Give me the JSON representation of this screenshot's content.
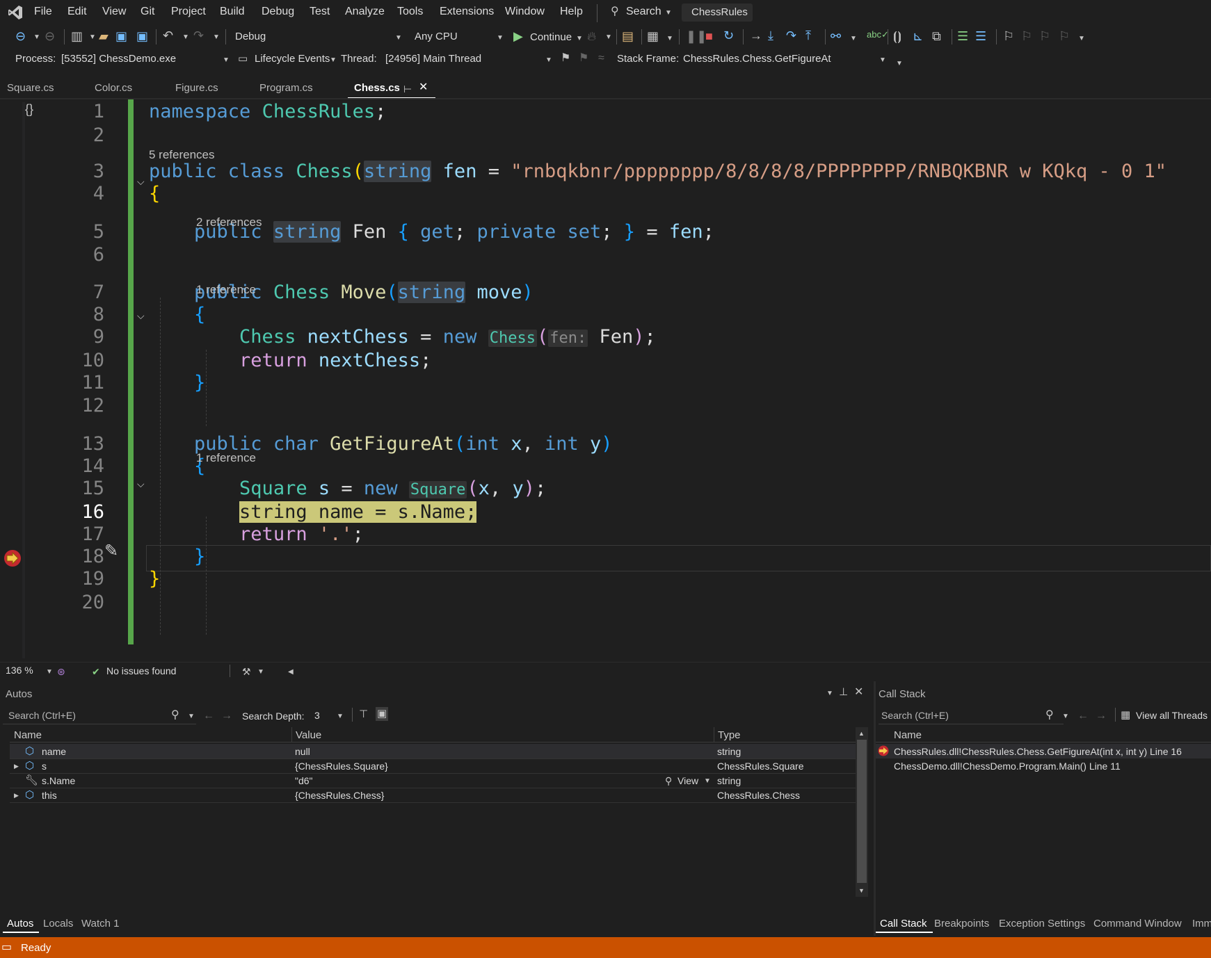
{
  "menu": {
    "items": [
      "File",
      "Edit",
      "View",
      "Git",
      "Project",
      "Build",
      "Debug",
      "Test",
      "Analyze",
      "Tools",
      "Extensions",
      "Window",
      "Help"
    ],
    "search_label": "Search",
    "solution_name": "ChessRules"
  },
  "toolbar": {
    "config": "Debug",
    "platform": "Any CPU",
    "continue_label": "Continue"
  },
  "debugbar": {
    "process_label": "Process:",
    "process_value": "[53552] ChessDemo.exe",
    "lifecycle_label": "Lifecycle Events",
    "thread_label": "Thread:",
    "thread_value": "[24956] Main Thread",
    "stackframe_label": "Stack Frame:",
    "stackframe_value": "ChessRules.Chess.GetFigureAt"
  },
  "tabs": [
    "Square.cs",
    "Color.cs",
    "Figure.cs",
    "Program.cs",
    "Chess.cs"
  ],
  "editor": {
    "refs": {
      "r3": "5 references",
      "r5": "2 references",
      "r7": "1 reference",
      "r13": "1 reference"
    },
    "lines": [
      {
        "n": "1",
        "tokens": [
          {
            "c": "k",
            "t": "namespace "
          },
          {
            "c": "t",
            "t": "ChessRules"
          },
          {
            "c": "w",
            "t": ";"
          }
        ]
      },
      {
        "n": "2",
        "tokens": []
      },
      {
        "n": "3",
        "tokens": [
          {
            "c": "k",
            "t": "public class "
          },
          {
            "c": "t",
            "t": "Chess"
          },
          {
            "c": "y",
            "t": "("
          },
          {
            "c": "k hl",
            "t": "string"
          },
          {
            "c": "p",
            "t": " fen"
          },
          {
            "c": "w",
            "t": " = "
          },
          {
            "c": "s",
            "t": "\"rnbqkbnr/pppppppp/8/8/8/8/PPPPPPPP/RNBQKBNR w KQkq - 0 1\""
          }
        ]
      },
      {
        "n": "4",
        "tokens": [
          {
            "c": "y",
            "t": "{"
          }
        ]
      },
      {
        "n": "5",
        "tokens": [
          {
            "c": "w",
            "t": "    "
          },
          {
            "c": "k",
            "t": "public "
          },
          {
            "c": "k hl",
            "t": "string"
          },
          {
            "c": "w",
            "t": " Fen "
          },
          {
            "c": "b",
            "t": "{"
          },
          {
            "c": "k",
            "t": " get"
          },
          {
            "c": "w",
            "t": "; "
          },
          {
            "c": "k",
            "t": "private set"
          },
          {
            "c": "w",
            "t": "; "
          },
          {
            "c": "b",
            "t": "}"
          },
          {
            "c": "w",
            "t": " = "
          },
          {
            "c": "p",
            "t": "fen"
          },
          {
            "c": "w",
            "t": ";"
          }
        ]
      },
      {
        "n": "6",
        "tokens": []
      },
      {
        "n": "7",
        "tokens": [
          {
            "c": "w",
            "t": "    "
          },
          {
            "c": "k",
            "t": "public "
          },
          {
            "c": "t",
            "t": "Chess "
          },
          {
            "c": "f",
            "t": "Move"
          },
          {
            "c": "b",
            "t": "("
          },
          {
            "c": "k hl",
            "t": "string"
          },
          {
            "c": "p",
            "t": " move"
          },
          {
            "c": "b",
            "t": ")"
          }
        ]
      },
      {
        "n": "8",
        "tokens": [
          {
            "c": "w",
            "t": "    "
          },
          {
            "c": "b",
            "t": "{"
          }
        ]
      },
      {
        "n": "9",
        "tokens": [
          {
            "c": "w",
            "t": "        "
          },
          {
            "c": "t",
            "t": "Chess "
          },
          {
            "c": "p",
            "t": "nextChess"
          },
          {
            "c": "w",
            "t": " = "
          },
          {
            "c": "k",
            "t": "new "
          },
          {
            "c": "t hint",
            "t": "Chess"
          },
          {
            "c": "c",
            "t": "("
          },
          {
            "c": "hint",
            "t": "fen:"
          },
          {
            "c": "w",
            "t": " Fen"
          },
          {
            "c": "c",
            "t": ")"
          },
          {
            "c": "w",
            "t": ";"
          }
        ]
      },
      {
        "n": "10",
        "tokens": [
          {
            "c": "w",
            "t": "        "
          },
          {
            "c": "c",
            "t": "return "
          },
          {
            "c": "p",
            "t": "nextChess"
          },
          {
            "c": "w",
            "t": ";"
          }
        ]
      },
      {
        "n": "11",
        "tokens": [
          {
            "c": "w",
            "t": "    "
          },
          {
            "c": "b",
            "t": "}"
          }
        ]
      },
      {
        "n": "12",
        "tokens": []
      },
      {
        "n": "13",
        "tokens": [
          {
            "c": "w",
            "t": "    "
          },
          {
            "c": "k",
            "t": "public char "
          },
          {
            "c": "f",
            "t": "GetFigureAt"
          },
          {
            "c": "b",
            "t": "("
          },
          {
            "c": "k",
            "t": "int "
          },
          {
            "c": "p",
            "t": "x"
          },
          {
            "c": "w",
            "t": ", "
          },
          {
            "c": "k",
            "t": "int "
          },
          {
            "c": "p",
            "t": "y"
          },
          {
            "c": "b",
            "t": ")"
          }
        ]
      },
      {
        "n": "14",
        "tokens": [
          {
            "c": "w",
            "t": "    "
          },
          {
            "c": "b",
            "t": "{"
          }
        ]
      },
      {
        "n": "15",
        "tokens": [
          {
            "c": "w",
            "t": "        "
          },
          {
            "c": "t",
            "t": "Square "
          },
          {
            "c": "p",
            "t": "s"
          },
          {
            "c": "w",
            "t": " = "
          },
          {
            "c": "k",
            "t": "new "
          },
          {
            "c": "t hint",
            "t": "Square"
          },
          {
            "c": "c",
            "t": "("
          },
          {
            "c": "p",
            "t": "x"
          },
          {
            "c": "w",
            "t": ", "
          },
          {
            "c": "p",
            "t": "y"
          },
          {
            "c": "c",
            "t": ")"
          },
          {
            "c": "w",
            "t": ";"
          }
        ]
      },
      {
        "n": "16",
        "tokens": [
          {
            "c": "w",
            "t": "        "
          },
          {
            "c": "cur",
            "t": "string name = s.Name;"
          }
        ]
      },
      {
        "n": "17",
        "tokens": [
          {
            "c": "w",
            "t": "        "
          },
          {
            "c": "c",
            "t": "return "
          },
          {
            "c": "s",
            "t": "'.'"
          },
          {
            "c": "w",
            "t": ";"
          }
        ]
      },
      {
        "n": "18",
        "tokens": [
          {
            "c": "w",
            "t": "    "
          },
          {
            "c": "b",
            "t": "}"
          }
        ]
      },
      {
        "n": "19",
        "tokens": [
          {
            "c": "y",
            "t": "}"
          }
        ]
      },
      {
        "n": "20",
        "tokens": []
      }
    ]
  },
  "editor_status": {
    "zoom": "136 %",
    "issues": "No issues found"
  },
  "autos": {
    "title": "Autos",
    "search_placeholder": "Search (Ctrl+E)",
    "depth_label": "Search Depth:",
    "depth_value": "3",
    "columns": [
      "Name",
      "Value",
      "Type"
    ],
    "rows": [
      {
        "name": "name",
        "value": "null",
        "type": "string",
        "expand": false,
        "icon": "cube"
      },
      {
        "name": "s",
        "value": "{ChessRules.Square}",
        "type": "ChessRules.Square",
        "expand": true,
        "icon": "cube"
      },
      {
        "name": "s.Name",
        "value": "\"d6\"",
        "type": "string",
        "expand": false,
        "icon": "wrench",
        "view": "View"
      },
      {
        "name": "this",
        "value": "{ChessRules.Chess}",
        "type": "ChessRules.Chess",
        "expand": true,
        "icon": "cube"
      }
    ],
    "bottom_tabs": [
      "Autos",
      "Locals",
      "Watch 1"
    ]
  },
  "callstack": {
    "title": "Call Stack",
    "search_placeholder": "Search (Ctrl+E)",
    "view_all": "View all Threads",
    "columns": [
      "Name"
    ],
    "rows": [
      {
        "name": "ChessRules.dll!ChessRules.Chess.GetFigureAt(int x, int y) Line 16",
        "current": true
      },
      {
        "name": "ChessDemo.dll!ChessDemo.Program.Main() Line 11",
        "current": false
      }
    ],
    "bottom_tabs": [
      "Call Stack",
      "Breakpoints",
      "Exception Settings",
      "Command Window",
      "Immediate Window"
    ]
  },
  "status": {
    "text": "Ready"
  }
}
